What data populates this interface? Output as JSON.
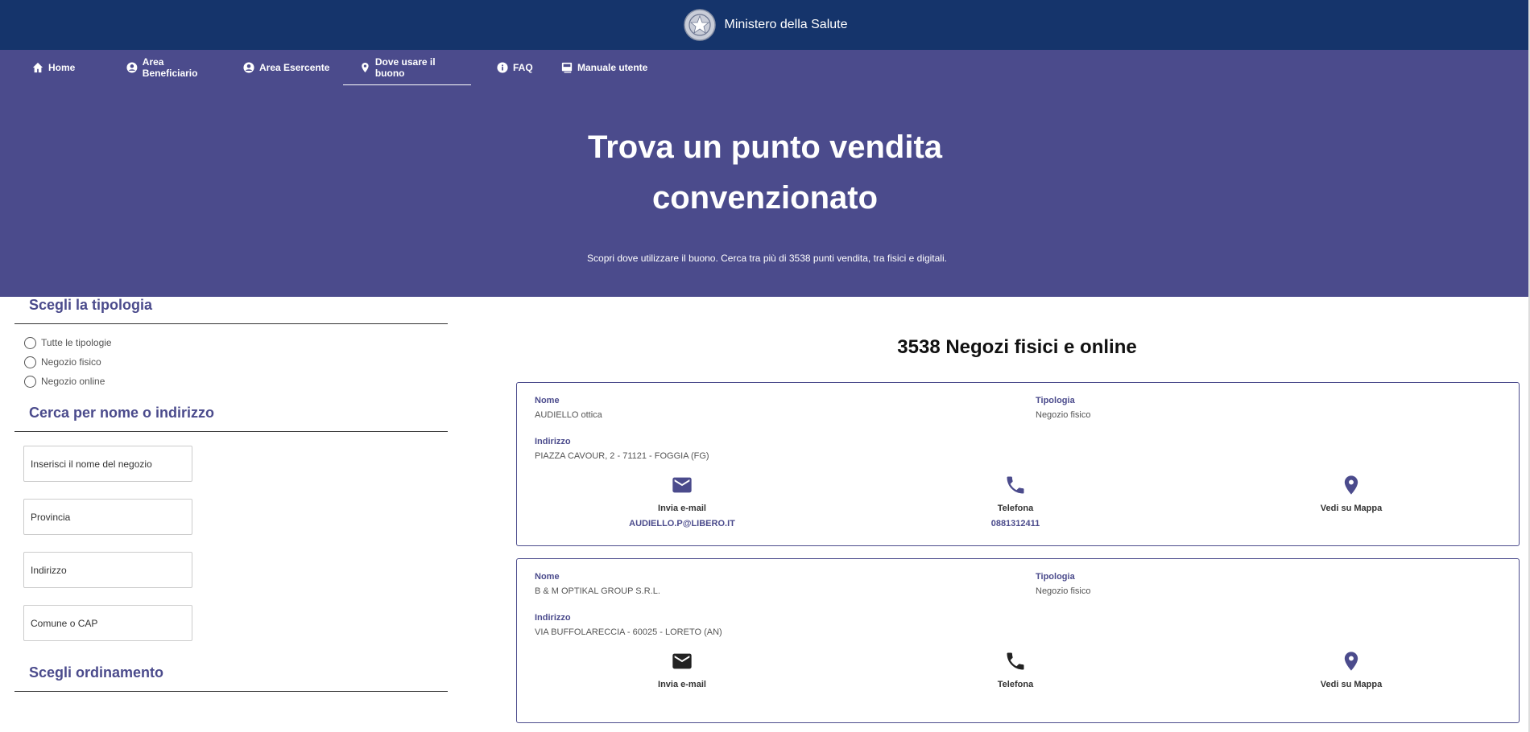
{
  "header": {
    "ministry": "Ministero della Salute"
  },
  "nav": [
    {
      "label": "Home"
    },
    {
      "label": "Area Beneficiario"
    },
    {
      "label": "Area Esercente"
    },
    {
      "label": "Dove usare il buono"
    },
    {
      "label": "FAQ"
    },
    {
      "label": "Manuale utente"
    }
  ],
  "hero": {
    "title_line1": "Trova un punto vendita",
    "title_line2": "convenzionato",
    "subtitle": "Scopri dove utilizzare il buono. Cerca tra più di 3538 punti vendita, tra fisici e digitali."
  },
  "filters": {
    "type_heading": "Scegli la tipologia",
    "type_options": [
      "Tutte le tipologie",
      "Negozio fisico",
      "Negozio online"
    ],
    "search_heading": "Cerca per nome o indirizzo",
    "search_placeholders": [
      "Inserisci il nome del negozio",
      "Provincia",
      "Indirizzo",
      "Comune o CAP"
    ],
    "order_heading": "Scegli ordinamento"
  },
  "results": {
    "count_title": "3538 Negozi fisici e online",
    "labels": {
      "name": "Nome",
      "type": "Tipologia",
      "address": "Indirizzo",
      "email": "Invia e-mail",
      "phone": "Telefona",
      "map": "Vedi su Mappa"
    },
    "stores": [
      {
        "name": "AUDIELLO ottica",
        "type": "Negozio fisico",
        "address": "PIAZZA CAVOUR, 2 - 71121 - FOGGIA (FG)",
        "email": "AUDIELLO.P@LIBERO.IT",
        "phone": "0881312411"
      },
      {
        "name": "B & M OPTIKAL GROUP S.R.L.",
        "type": "Negozio fisico",
        "address": "VIA BUFFOLARECCIA - 60025 - LORETO (AN)",
        "email": "",
        "phone": ""
      }
    ]
  },
  "colors": {
    "topbar": "#15346b",
    "hero": "#4b4b8c",
    "accent": "#4b4b8c"
  }
}
